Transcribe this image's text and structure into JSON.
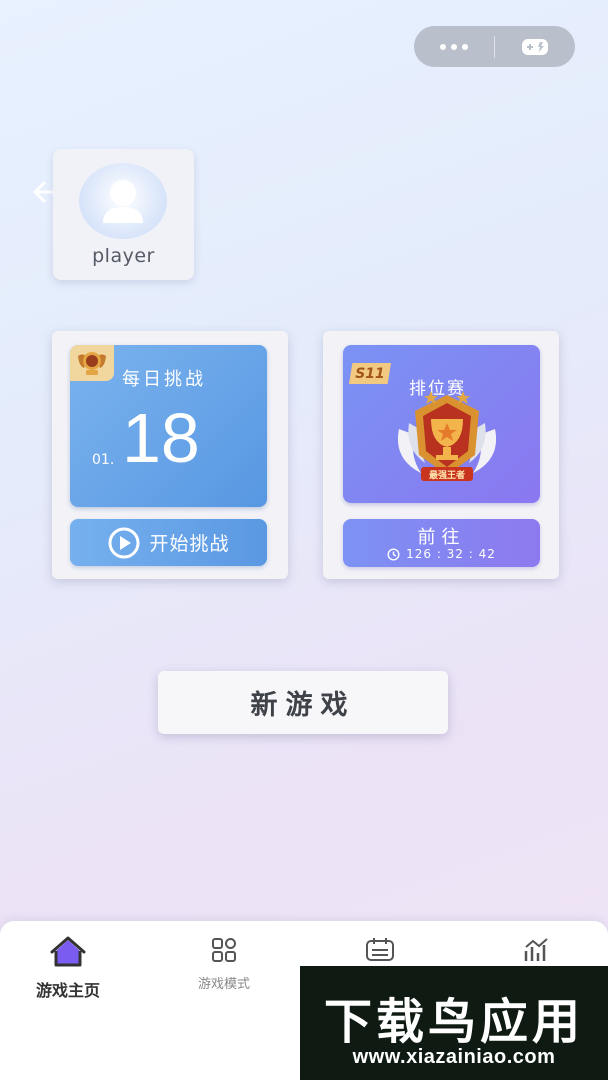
{
  "profile": {
    "name": "player"
  },
  "daily_challenge": {
    "title": "每日挑战",
    "day": "18",
    "month": "01.",
    "start_label": "开始挑战"
  },
  "ranked": {
    "season": "S11",
    "title": "排位赛",
    "badge_text": "最强王者",
    "go_label": "前往",
    "timer": "126 : 32 : 42"
  },
  "new_game_label": "新游戏",
  "nav": {
    "home_label": "游戏主页",
    "modes_label": "游戏模式"
  },
  "watermark": {
    "brand": "下载鸟应用",
    "url": "www.xiazainiao.com"
  },
  "colors": {
    "daily_blue": "#5797e2",
    "rank_purple": "#8a77f0",
    "capsule_gray": "#b9c0cc",
    "home_icon_purple": "#7b5cf0"
  },
  "icons": [
    "more-dots-icon",
    "gamepad-icon",
    "back-arrow-icon",
    "avatar-icon",
    "medal-icon",
    "play-circle-icon",
    "trophy-icon",
    "clock-icon",
    "home-icon",
    "grid-icon",
    "calendar-icon",
    "chart-icon"
  ]
}
